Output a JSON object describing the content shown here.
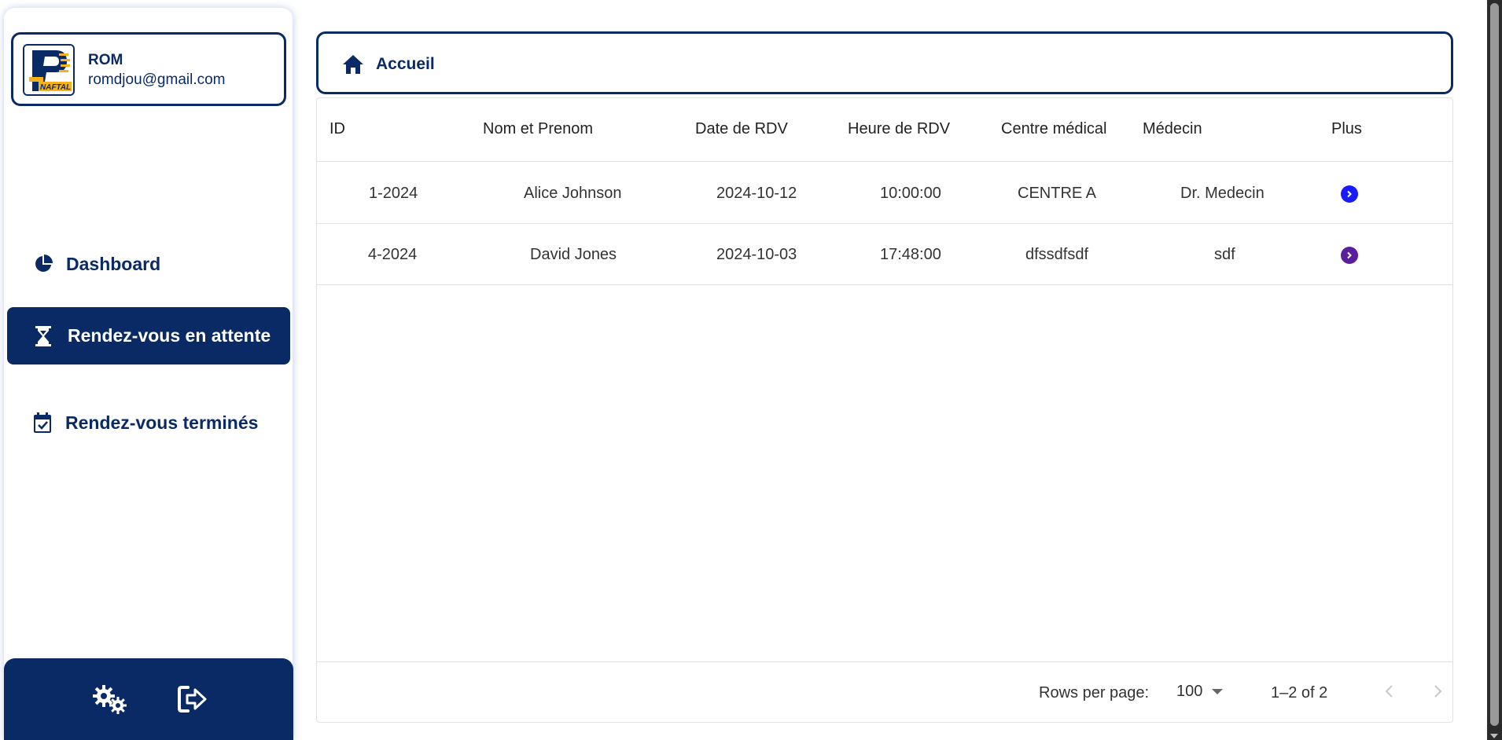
{
  "user": {
    "name": "ROM",
    "email": "romdjou@gmail.com",
    "logo_text": "NAFTAL"
  },
  "nav": [
    {
      "label": "Dashboard",
      "icon": "pie-chart-icon"
    },
    {
      "label": "Rendez-vous en attente",
      "icon": "hourglass-icon",
      "active": true
    },
    {
      "label": "Rendez-vous terminés",
      "icon": "calendar-check-icon"
    }
  ],
  "bottom_actions": {
    "settings_icon": "gears-icon",
    "logout_icon": "logout-icon"
  },
  "header": {
    "title": "Accueil",
    "icon": "home-icon"
  },
  "table": {
    "columns": [
      "ID",
      "Nom et Prenom",
      "Date de RDV",
      "Heure de RDV",
      "Centre médical",
      "Médecin",
      "Plus"
    ],
    "rows": [
      {
        "id": "1-2024",
        "name": "Alice Johnson",
        "date": "2024-10-12",
        "time": "10:00:00",
        "center": "CENTRE A",
        "doctor": "Dr. Medecin",
        "more_color": "#1a1aff"
      },
      {
        "id": "4-2024",
        "name": "David Jones",
        "date": "2024-10-03",
        "time": "17:48:00",
        "center": "dfssdfsdf",
        "doctor": "sdf",
        "more_color": "#5b1f9e"
      }
    ]
  },
  "pagination": {
    "rows_per_page_label": "Rows per page:",
    "rows_per_page": "100",
    "range": "1–2 of 2"
  },
  "colors": {
    "primary": "#0a2a66",
    "accent": "#f5b21a"
  }
}
